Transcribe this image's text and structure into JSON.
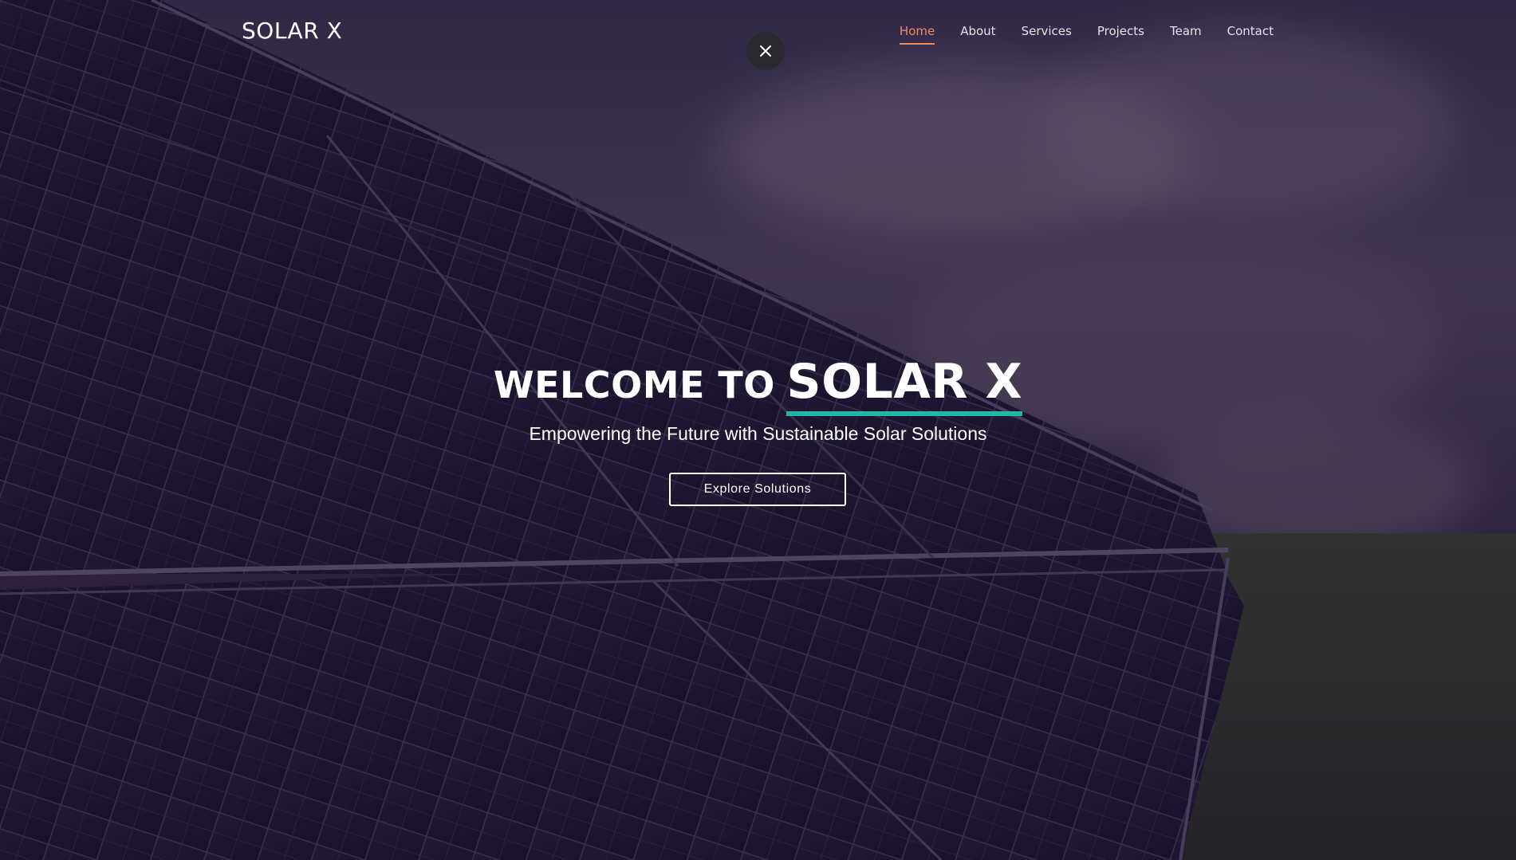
{
  "header": {
    "logo": "SOLAR X",
    "close_icon": "close-icon",
    "nav": [
      {
        "label": "Home",
        "active": true
      },
      {
        "label": "About",
        "active": false
      },
      {
        "label": "Services",
        "active": false
      },
      {
        "label": "Projects",
        "active": false
      },
      {
        "label": "Team",
        "active": false
      },
      {
        "label": "Contact",
        "active": false
      }
    ]
  },
  "hero": {
    "title_prefix": "WELCOME TO",
    "title_brand": "SOLAR X",
    "subtitle": "Empowering the Future with Sustainable Solar Solutions",
    "cta_label": "Explore Solutions"
  },
  "colors": {
    "accent_nav": "#f08a5d",
    "accent_underline": "#27b5a5",
    "overlay": "rgba(30, 18, 44, 0.55)"
  }
}
